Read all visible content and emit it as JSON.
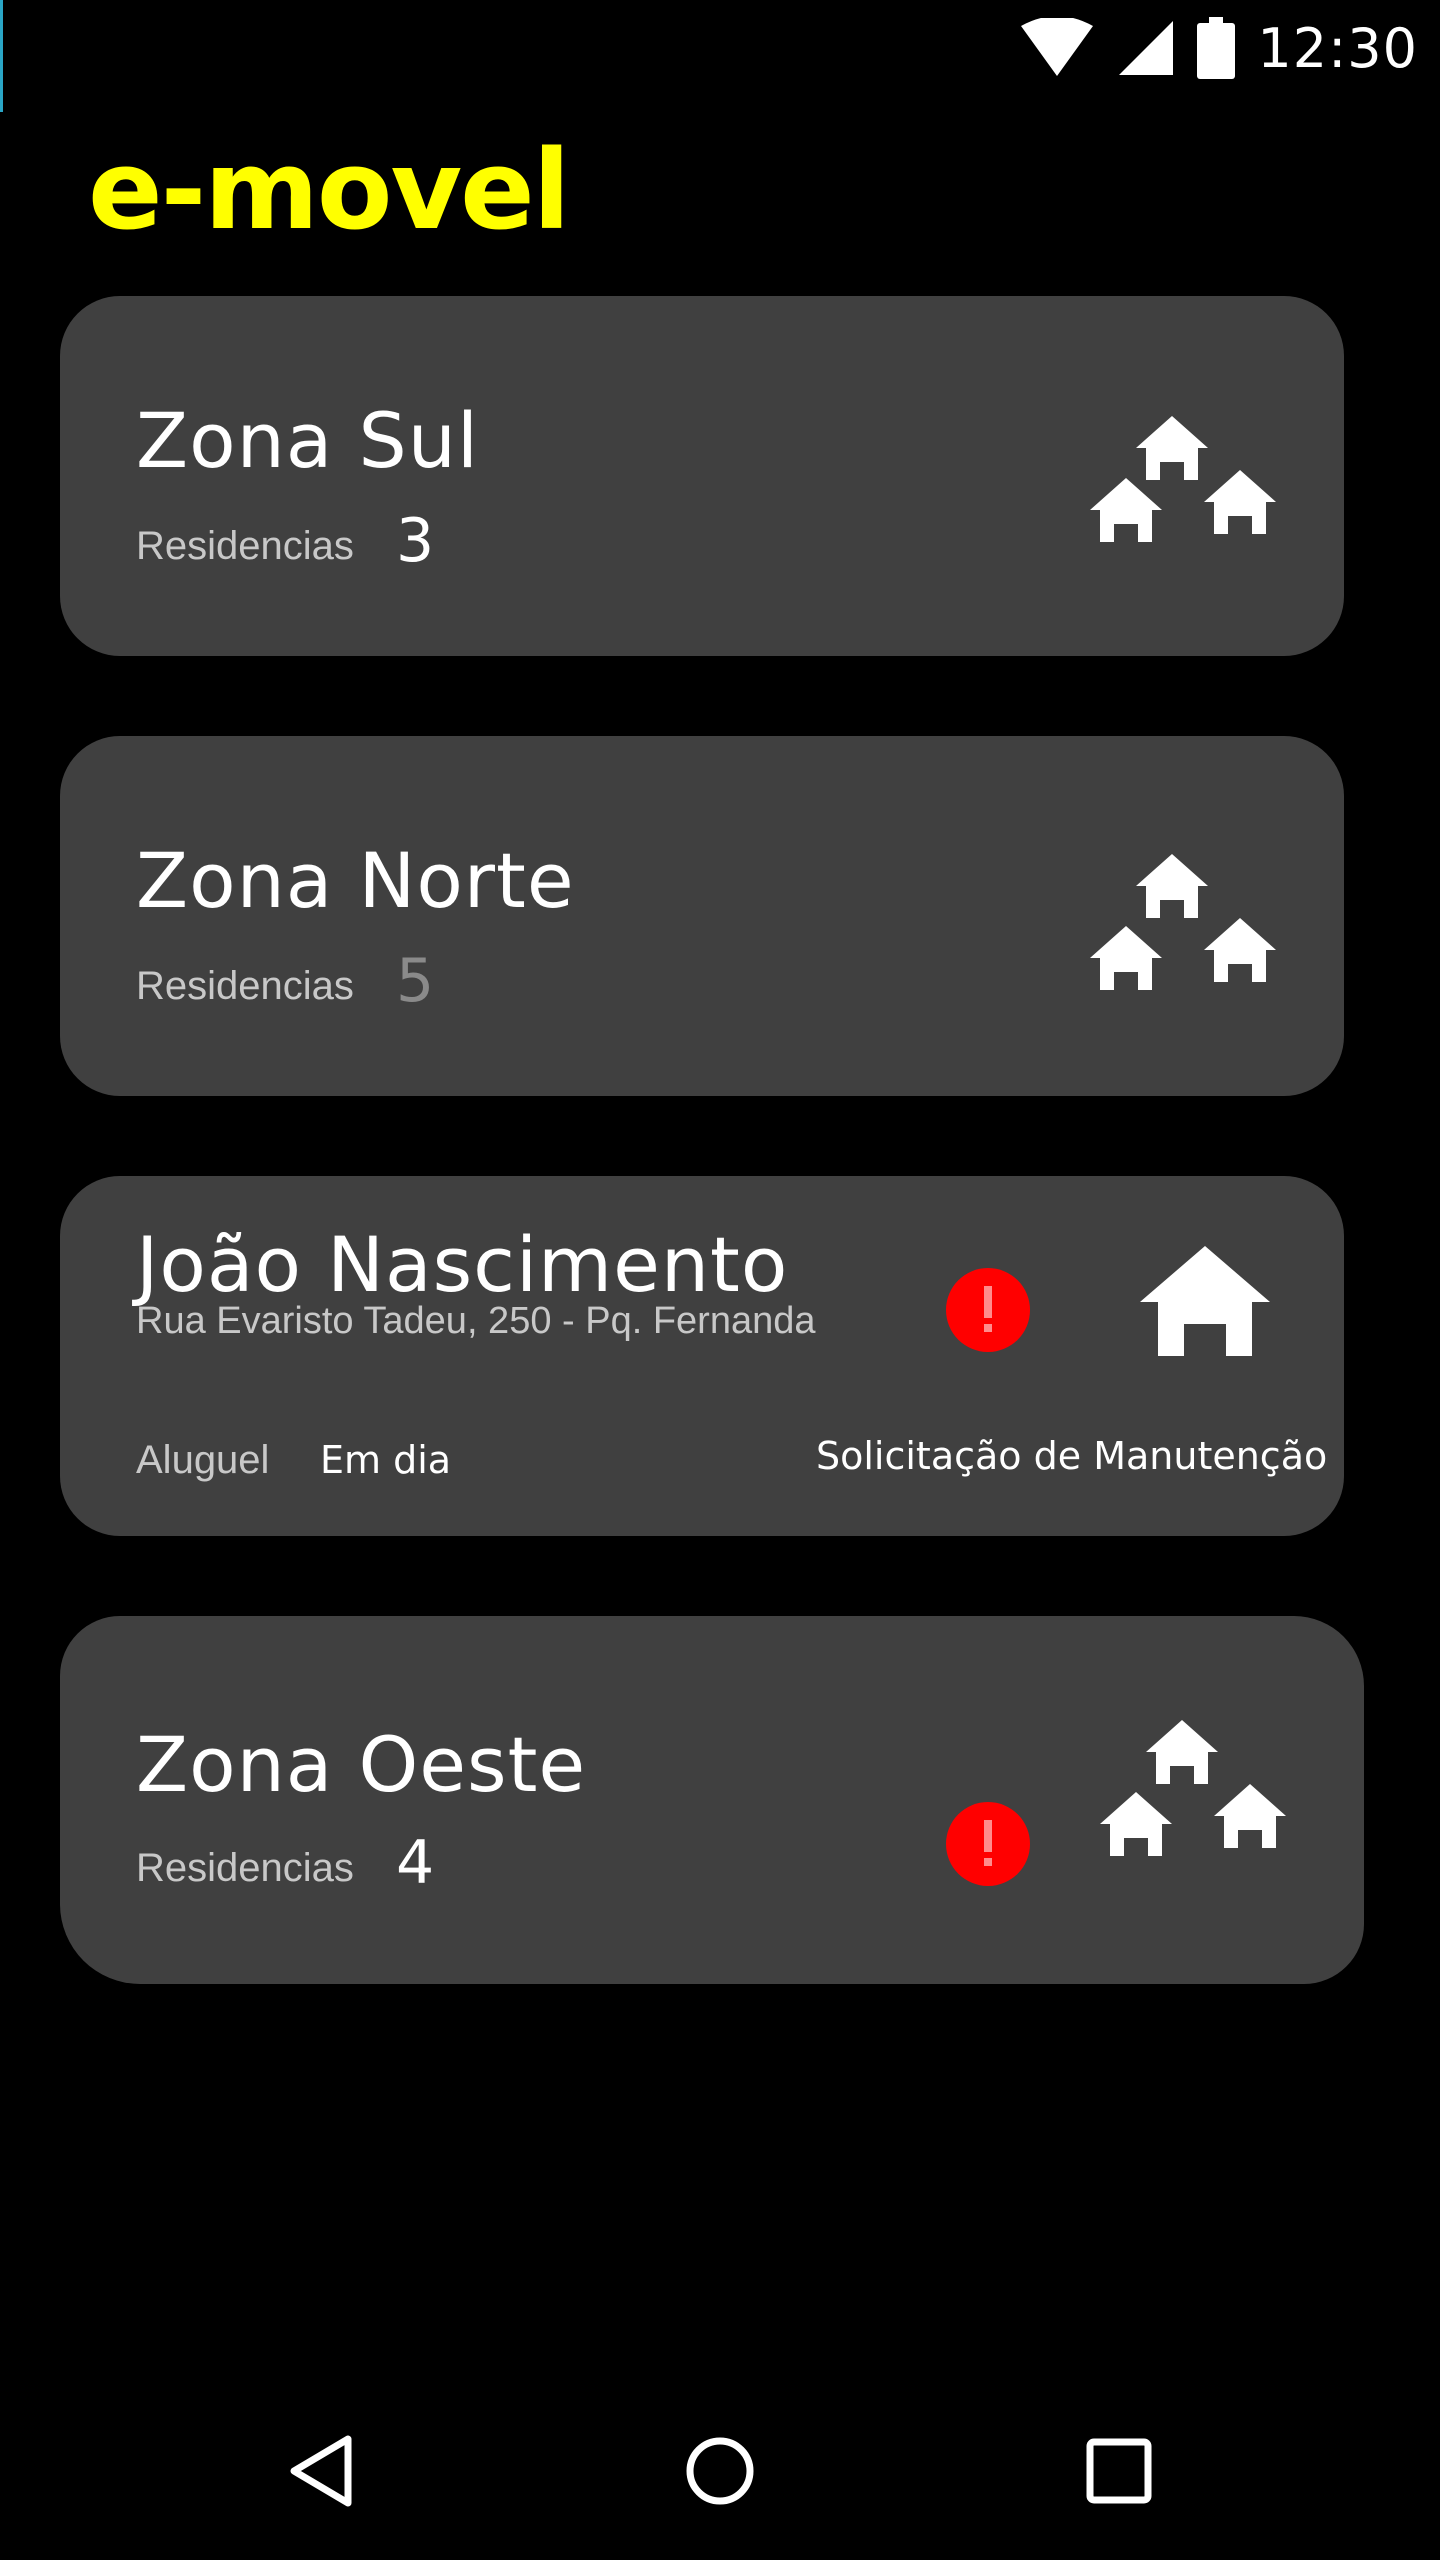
{
  "status_bar": {
    "time": "12:30",
    "icons": [
      "wifi-icon",
      "signal-icon",
      "battery-icon"
    ]
  },
  "app": {
    "title": "e-movel",
    "title_color": "#ffff00"
  },
  "cards": [
    {
      "title": "Zona Sul",
      "label": "Residencias",
      "count": "3",
      "icon": "houses-icon"
    },
    {
      "title": "Zona Norte",
      "label": "Residencias",
      "count": "5",
      "icon": "houses-icon"
    },
    {
      "title": "João Nascimento",
      "address": "Rua Evaristo Tadeu, 250 - Pq. Fernanda",
      "rent_label": "Aluguel",
      "rent_status": "Em dia",
      "request": "Solicitação de Manutenção",
      "alert_icon": "alert-icon",
      "icon": "house-icon"
    },
    {
      "title": "Zona Oeste",
      "label": "Residencias",
      "count": "4",
      "alert_icon": "alert-icon",
      "icon": "houses-icon"
    }
  ],
  "colors": {
    "background": "#000000",
    "card": "#404040",
    "alert": "#ff0000"
  },
  "nav": [
    "back-icon",
    "home-icon",
    "recents-icon"
  ]
}
